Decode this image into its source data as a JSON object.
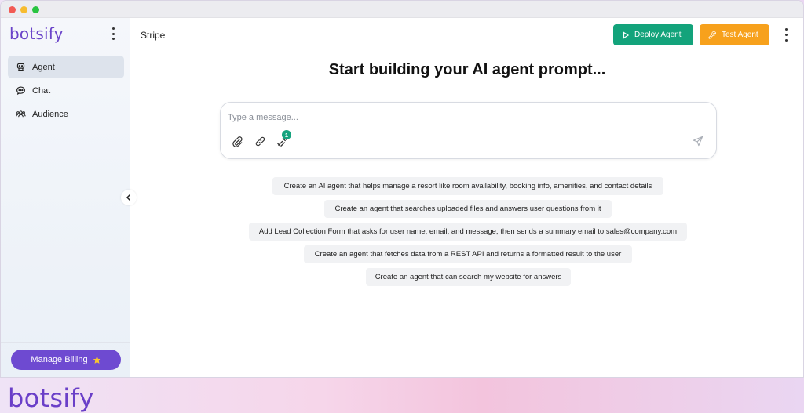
{
  "sidebar": {
    "brand": "botsify",
    "items": [
      {
        "label": "Agent",
        "icon": "robot-icon",
        "active": true
      },
      {
        "label": "Chat",
        "icon": "chat-bubble-icon",
        "active": false
      },
      {
        "label": "Audience",
        "icon": "users-icon",
        "active": false
      }
    ],
    "billing_label": "Manage Billing",
    "billing_icon": "star-icon"
  },
  "header": {
    "title": "Stripe",
    "deploy_label": "Deploy Agent",
    "test_label": "Test Agent"
  },
  "main": {
    "title": "Start building your AI agent prompt...",
    "composer": {
      "placeholder": "Type a message...",
      "tools_badge": "1"
    },
    "suggestions": [
      "Create an AI agent that helps manage a resort like room availability, booking info, amenities, and contact details",
      "Create an agent that searches uploaded files and answers user questions from it",
      "Add Lead Collection Form that asks for user name, email, and message, then sends a summary email to sales@company.com",
      "Create an agent that fetches data from a REST API and returns a formatted result to the user",
      "Create an agent that can search my website for answers"
    ]
  },
  "footer": {
    "brand": "botsify"
  },
  "colors": {
    "brand": "#6a44c9",
    "deploy": "#13a37b",
    "test": "#f7a11c",
    "billing": "#6e4ad1"
  }
}
